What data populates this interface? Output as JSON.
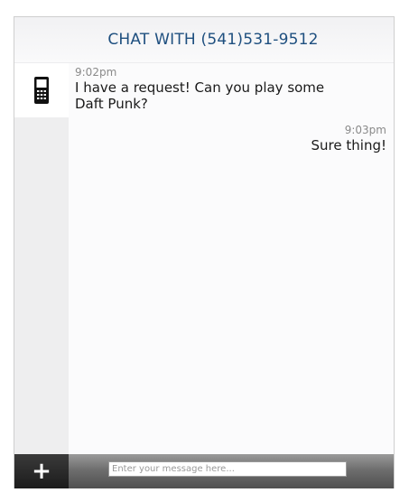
{
  "header": {
    "title": "CHAT WITH (541)531-9512"
  },
  "contact": {
    "icon": "mobile-phone-icon"
  },
  "messages": [
    {
      "direction": "incoming",
      "time": "9:02pm",
      "text": "I have a request! Can you play some Daft Punk?"
    },
    {
      "direction": "outgoing",
      "time": "9:03pm",
      "text": "Sure thing!"
    }
  ],
  "footer": {
    "add_icon": "plus-icon",
    "input_placeholder": "Enter your message here...",
    "input_value": ""
  },
  "colors": {
    "title": "#1e4f7f",
    "time": "#8a8a8a",
    "footer": "#6e6e6e"
  }
}
